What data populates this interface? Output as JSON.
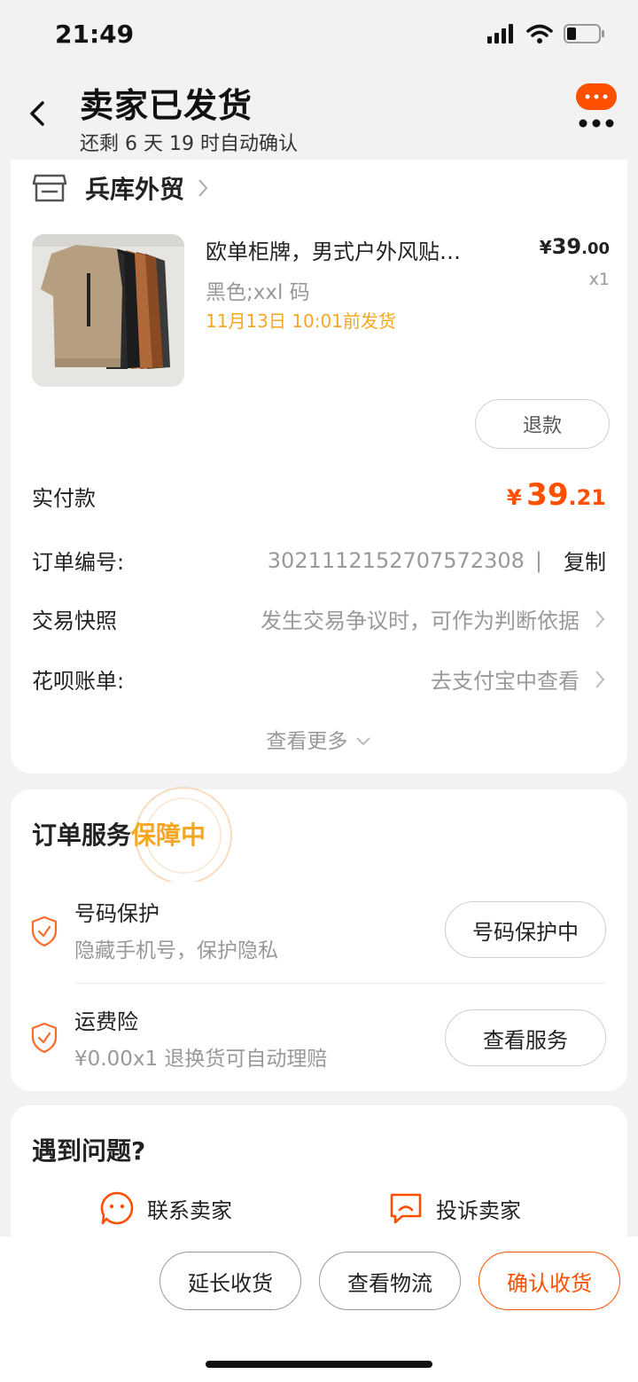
{
  "status_bar": {
    "time": "21:49"
  },
  "header": {
    "title": "卖家已发货",
    "subtitle": "还剩 6 天 19 时自动确认"
  },
  "shop": {
    "name": "兵库外贸"
  },
  "product": {
    "title": "欧单柜牌，男式户外风贴…",
    "sku": "黑色;xxl 码",
    "ship_deadline": "11月13日 10:01前发货",
    "price_symbol": "¥",
    "price_int": "39",
    "price_dec": ".00",
    "qty": "x1",
    "refund_label": "退款"
  },
  "order": {
    "paid_label": "实付款",
    "paid_symbol": "¥",
    "paid_int": "39",
    "paid_dec": ".21",
    "number_label": "订单编号:",
    "number": "3021112152707572308",
    "copy_label": "复制",
    "separator": "|",
    "snapshot_label": "交易快照",
    "snapshot_value": "发生交易争议时，可作为判断依据",
    "huabei_label": "花呗账单:",
    "huabei_value": "去支付宝中查看",
    "see_more": "查看更多"
  },
  "service": {
    "title_prefix": "订单服务",
    "title_highlight": "保障中",
    "items": [
      {
        "name": "号码保护",
        "desc": "隐藏手机号，保护隐私",
        "button": "号码保护中"
      },
      {
        "name": "运费险",
        "desc": "¥0.00x1 退换货可自动理赔",
        "button": "查看服务"
      }
    ]
  },
  "help": {
    "title": "遇到问题?",
    "contact_label": "联系卖家",
    "complain_label": "投诉卖家"
  },
  "bottom_bar": {
    "extend_label": "延长收货",
    "logistics_label": "查看物流",
    "confirm_label": "确认收货"
  },
  "colors": {
    "accent": "#ff5000",
    "highlight": "#f5a623",
    "muted": "#999999",
    "background": "#f2f2f2"
  }
}
